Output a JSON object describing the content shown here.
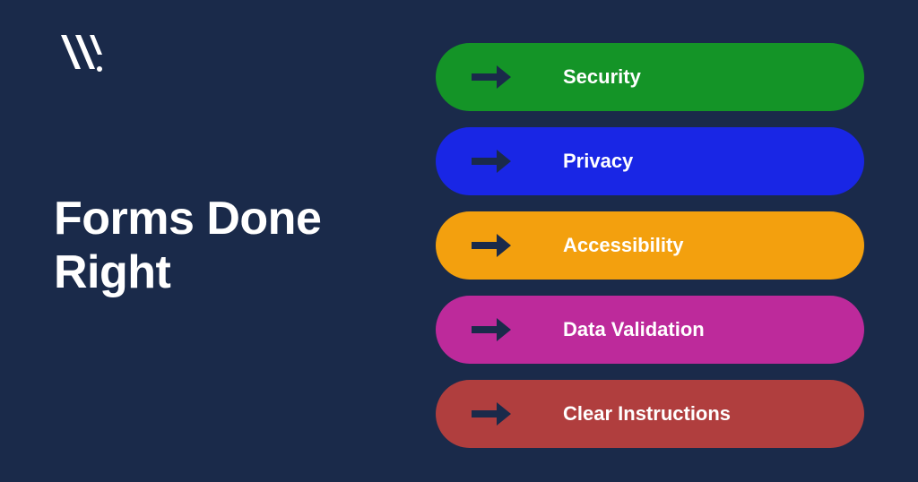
{
  "title": "Forms Done\nRight",
  "pills": [
    {
      "label": "Security",
      "color": "#149427"
    },
    {
      "label": "Privacy",
      "color": "#1926e5"
    },
    {
      "label": "Accessibility",
      "color": "#f3a00e"
    },
    {
      "label": "Data Validation",
      "color": "#bd2a9b"
    },
    {
      "label": "Clear Instructions",
      "color": "#b03e3e"
    }
  ],
  "arrowFill": "#1a2a4a"
}
